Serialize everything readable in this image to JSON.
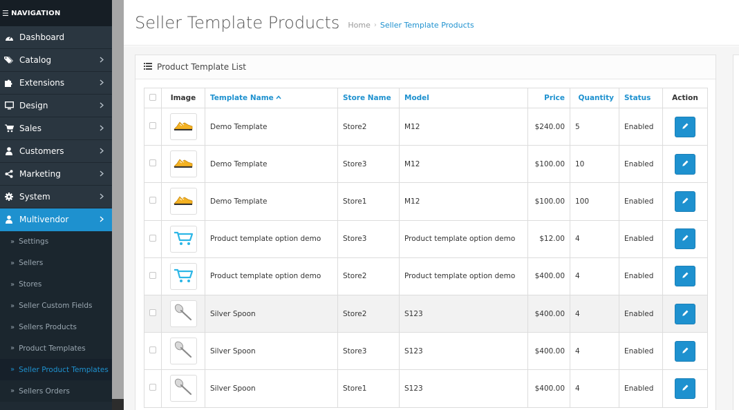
{
  "sidebar": {
    "header": "NAVIGATION",
    "menu": [
      {
        "label": "Dashboard",
        "icon": "dashboard-icon",
        "has_chevron": false
      },
      {
        "label": "Catalog",
        "icon": "tags-icon",
        "has_chevron": true
      },
      {
        "label": "Extensions",
        "icon": "puzzle-icon",
        "has_chevron": true
      },
      {
        "label": "Design",
        "icon": "monitor-icon",
        "has_chevron": true
      },
      {
        "label": "Sales",
        "icon": "cart-icon",
        "has_chevron": true
      },
      {
        "label": "Customers",
        "icon": "user-icon",
        "has_chevron": true
      },
      {
        "label": "Marketing",
        "icon": "share-icon",
        "has_chevron": true
      },
      {
        "label": "System",
        "icon": "cog-icon",
        "has_chevron": true
      },
      {
        "label": "Multivendor",
        "icon": "user-icon",
        "has_chevron": true,
        "active": true
      }
    ],
    "submenu": [
      {
        "label": "Settings"
      },
      {
        "label": "Sellers"
      },
      {
        "label": "Stores"
      },
      {
        "label": "Seller Custom Fields"
      },
      {
        "label": "Sellers Products"
      },
      {
        "label": "Product Templates"
      },
      {
        "label": "Seller Product Templates",
        "active": true
      },
      {
        "label": "Sellers Orders"
      }
    ]
  },
  "page": {
    "title": "Seller Template Products",
    "breadcrumb_home": "Home",
    "breadcrumb_sep": "›",
    "breadcrumb_current": "Seller Template Products"
  },
  "panel": {
    "title": "Product Template List"
  },
  "table": {
    "headers": {
      "image": "Image",
      "template_name": "Template Name",
      "store_name": "Store Name",
      "model": "Model",
      "price": "Price",
      "quantity": "Quantity",
      "status": "Status",
      "action": "Action"
    },
    "rows": [
      {
        "thumb": "shoe",
        "name": "Demo Template",
        "store": "Store2",
        "model": "M12",
        "price": "$240.00",
        "quantity": "5",
        "status": "Enabled"
      },
      {
        "thumb": "shoe",
        "name": "Demo Template",
        "store": "Store3",
        "model": "M12",
        "price": "$100.00",
        "quantity": "10",
        "status": "Enabled"
      },
      {
        "thumb": "shoe",
        "name": "Demo Template",
        "store": "Store1",
        "model": "M12",
        "price": "$100.00",
        "quantity": "100",
        "status": "Enabled"
      },
      {
        "thumb": "cart",
        "name": "Product template option demo",
        "store": "Store3",
        "model": "Product template option demo",
        "price": "$12.00",
        "quantity": "4",
        "status": "Enabled"
      },
      {
        "thumb": "cart",
        "name": "Product template option demo",
        "store": "Store2",
        "model": "Product template option demo",
        "price": "$400.00",
        "quantity": "4",
        "status": "Enabled"
      },
      {
        "thumb": "spoon",
        "name": "Silver Spoon",
        "store": "Store2",
        "model": "S123",
        "price": "$400.00",
        "quantity": "4",
        "status": "Enabled",
        "highlight": true
      },
      {
        "thumb": "spoon",
        "name": "Silver Spoon",
        "store": "Store3",
        "model": "S123",
        "price": "$400.00",
        "quantity": "4",
        "status": "Enabled"
      },
      {
        "thumb": "spoon",
        "name": "Silver Spoon",
        "store": "Store1",
        "model": "S123",
        "price": "$400.00",
        "quantity": "4",
        "status": "Enabled"
      }
    ]
  },
  "colors": {
    "accent": "#1e91cf",
    "sidebar_bg": "#2a3640",
    "sidebar_dark": "#1b262e"
  }
}
